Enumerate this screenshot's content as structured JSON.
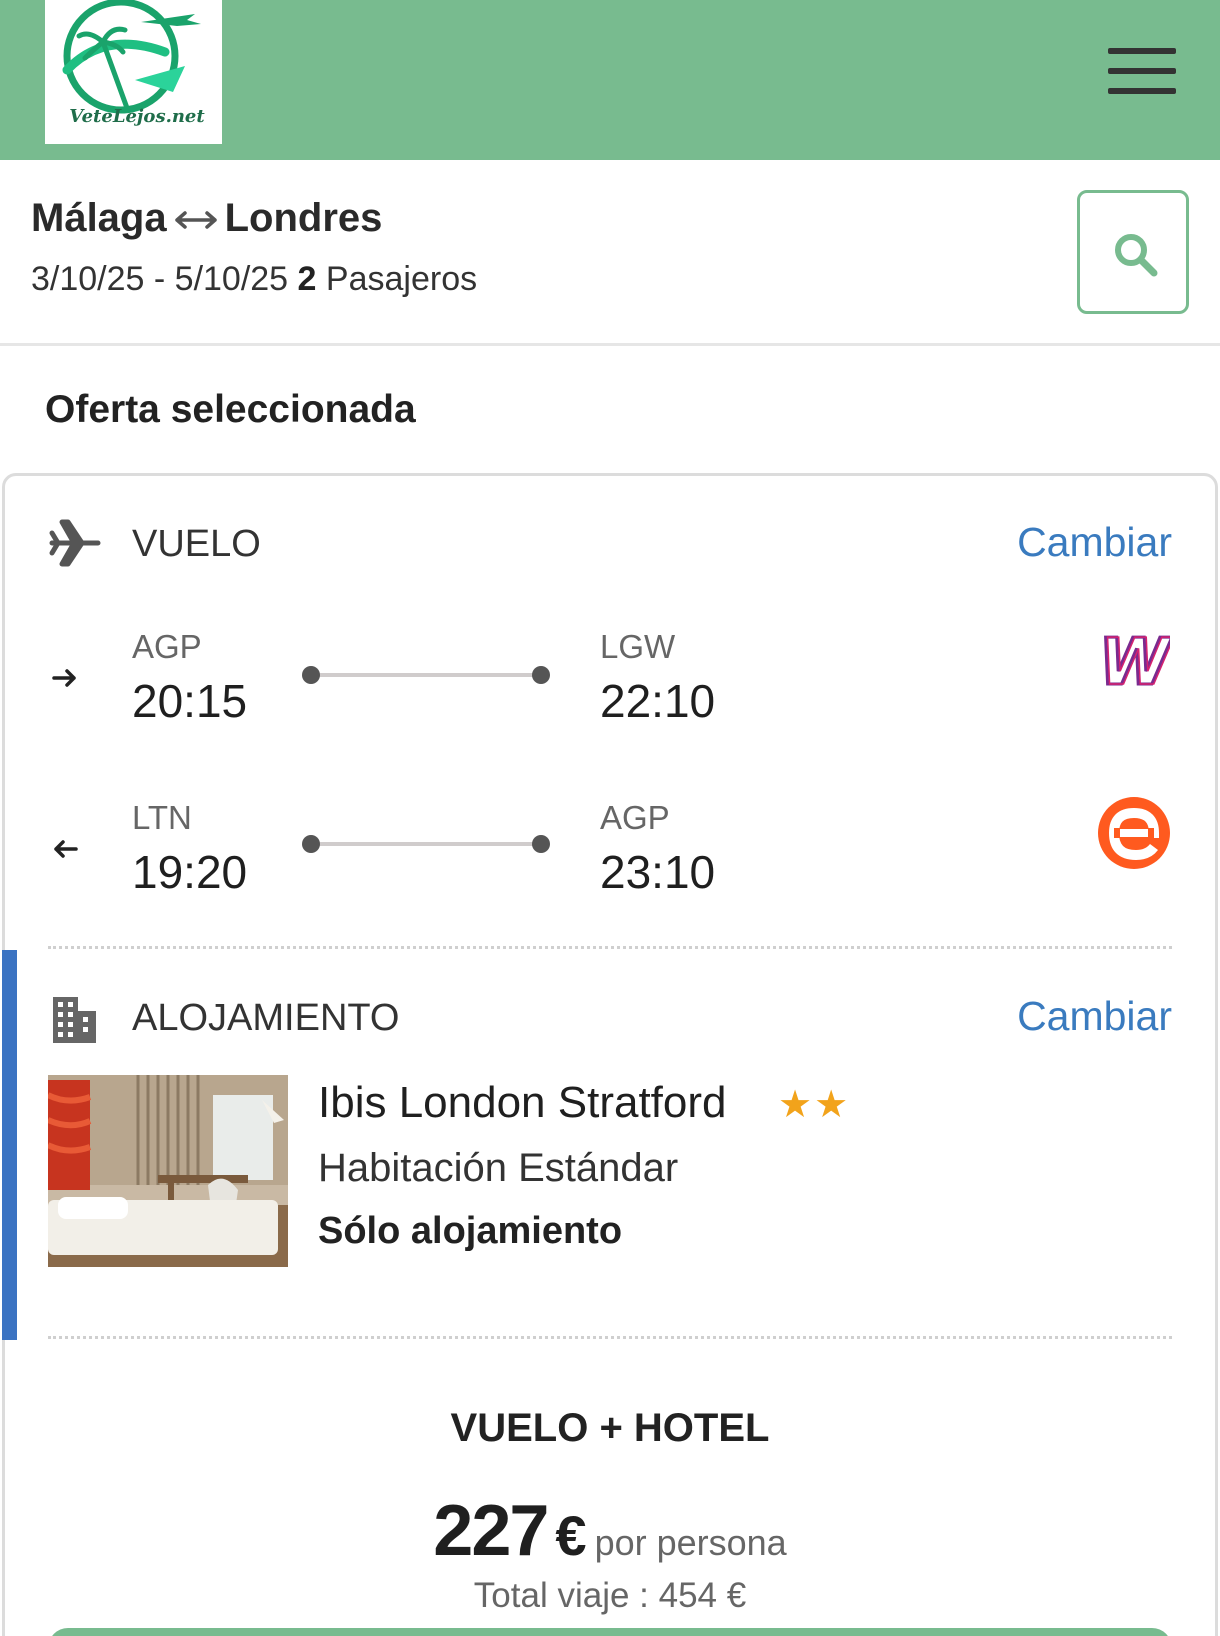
{
  "header": {
    "logo_text": "VeteLejos.net",
    "menu_icon": "hamburger-menu-icon",
    "brand_color": "#78bb8f"
  },
  "search": {
    "origin": "Málaga",
    "destination": "Londres",
    "dates": "3/10/25 - 5/10/25",
    "passengers_count": "2",
    "passengers_label": "Pasajeros",
    "search_icon": "search-icon"
  },
  "offer": {
    "title": "Oferta seleccionada",
    "flight": {
      "label": "VUELO",
      "change": "Cambiar",
      "outbound": {
        "from_code": "AGP",
        "from_time": "20:15",
        "to_code": "LGW",
        "to_time": "22:10",
        "airline_icon": "wizz-air-logo"
      },
      "inbound": {
        "from_code": "LTN",
        "from_time": "19:20",
        "to_code": "AGP",
        "to_time": "23:10",
        "airline_icon": "easyjet-logo"
      }
    },
    "hotel": {
      "label": "ALOJAMIENTO",
      "change": "Cambiar",
      "name": "Ibis London Stratford",
      "stars": 2,
      "room": "Habitación Estándar",
      "board": "Sólo alojamiento"
    },
    "package": {
      "label": "VUELO + HOTEL",
      "price": "227",
      "currency": "€",
      "per_person": "por persona",
      "total": "Total viaje : 454 €"
    }
  },
  "colors": {
    "accent_blue": "#3b73c2",
    "link": "#3a7bbf",
    "star": "#f2a31b"
  }
}
